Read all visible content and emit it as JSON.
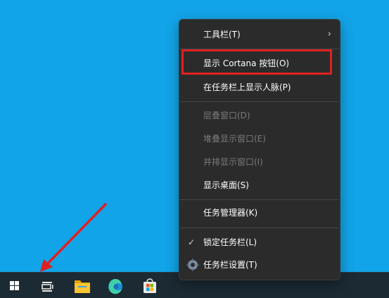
{
  "context_menu": {
    "items": [
      {
        "label": "工具栏(T)",
        "enabled": true,
        "submenu": true
      },
      {
        "label": "显示 Cortana 按钮(O)",
        "enabled": true,
        "highlighted": true
      },
      {
        "label": "在任务栏上显示人脉(P)",
        "enabled": true
      },
      {
        "label": "层叠窗口(D)",
        "enabled": false
      },
      {
        "label": "堆叠显示窗口(E)",
        "enabled": false
      },
      {
        "label": "并排显示窗口(I)",
        "enabled": false
      },
      {
        "label": "显示桌面(S)",
        "enabled": true
      },
      {
        "label": "任务管理器(K)",
        "enabled": true
      },
      {
        "label": "锁定任务栏(L)",
        "enabled": true,
        "checked": true
      },
      {
        "label": "任务栏设置(T)",
        "enabled": true,
        "icon": "gear-icon"
      }
    ]
  },
  "taskbar": {
    "buttons": [
      {
        "name": "start-button",
        "icon": "windows-logo-icon"
      },
      {
        "name": "task-view-button",
        "icon": "task-view-icon"
      },
      {
        "name": "file-explorer-button",
        "icon": "folder-icon"
      },
      {
        "name": "edge-button",
        "icon": "edge-icon"
      },
      {
        "name": "store-button",
        "icon": "store-icon"
      }
    ]
  },
  "colors": {
    "desktop": "#12a4e8",
    "taskbar": "#1c2a33",
    "menu_bg": "#2b2b2b",
    "highlight_box": "#e02020",
    "annotation_arrow": "#e02020"
  }
}
